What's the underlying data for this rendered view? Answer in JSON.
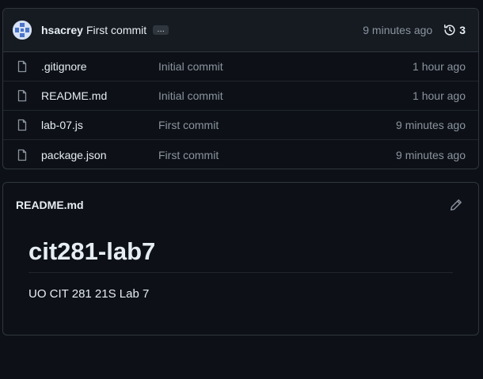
{
  "commit": {
    "author": "hsacrey",
    "message": "First commit",
    "ellipsis": "…",
    "time": "9 minutes ago",
    "history_count": "3"
  },
  "files": [
    {
      "name": ".gitignore",
      "commit": "Initial commit",
      "time": "1 hour ago"
    },
    {
      "name": "README.md",
      "commit": "Initial commit",
      "time": "1 hour ago"
    },
    {
      "name": "lab-07.js",
      "commit": "First commit",
      "time": "9 minutes ago"
    },
    {
      "name": "package.json",
      "commit": "First commit",
      "time": "9 minutes ago"
    }
  ],
  "readme": {
    "title": "README.md",
    "heading": "cit281-lab7",
    "paragraph": "UO CIT 281 21S Lab 7"
  },
  "icons": {
    "file": "file-icon",
    "history": "history-icon",
    "edit": "pencil-icon"
  },
  "colors": {
    "background": "#0d1117",
    "header_bg": "#161b22",
    "border": "#30363d",
    "text": "#e6edf3",
    "muted": "#8b949e"
  }
}
